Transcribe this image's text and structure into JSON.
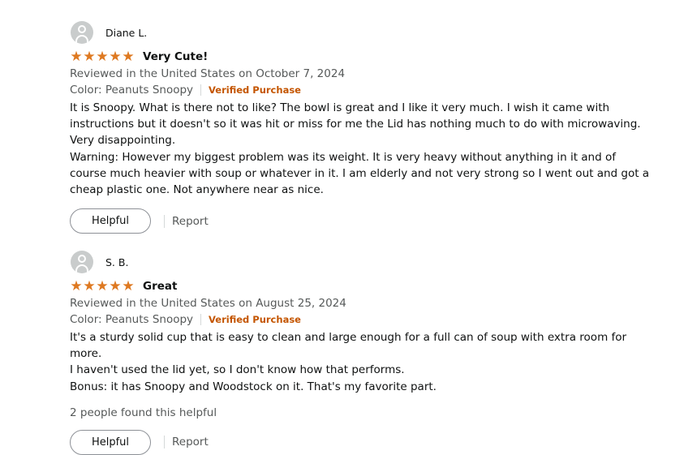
{
  "colors": {
    "star": "#de7921",
    "verified": "#c45500",
    "muted_text": "#565959"
  },
  "reviews": [
    {
      "name": "Diane L.",
      "rating": 5,
      "title": "Very Cute!",
      "date_line": "Reviewed in the United States on October 7, 2024",
      "variant": "Color: Peanuts Snoopy",
      "verified": "Verified Purchase",
      "body": [
        "It is Snoopy. What is there not to like? The bowl is great and I like it very much. I wish it came with instructions but it doesn't so it was hit or miss for me the Lid has nothing much to do with microwaving. Very disappointing.",
        "Warning: However my biggest problem was its weight. It is very heavy without anything in it and of course much heavier with soup or whatever in it. I am elderly and not very strong so I went out and got a cheap plastic one. Not anywhere near as nice."
      ],
      "helpful_count_text": "",
      "helpful_label": "Helpful",
      "report_label": "Report"
    },
    {
      "name": "S. B.",
      "rating": 5,
      "title": "Great",
      "date_line": "Reviewed in the United States on August 25, 2024",
      "variant": "Color: Peanuts Snoopy",
      "verified": "Verified Purchase",
      "body": [
        "It's a sturdy solid cup that is easy to clean and large enough for a full can of soup with extra room for more.",
        "I haven't used the lid yet, so I don't know how that performs.",
        "Bonus: it has Snoopy and Woodstock on it. That's my favorite part."
      ],
      "helpful_count_text": "2 people found this helpful",
      "helpful_label": "Helpful",
      "report_label": "Report"
    }
  ]
}
